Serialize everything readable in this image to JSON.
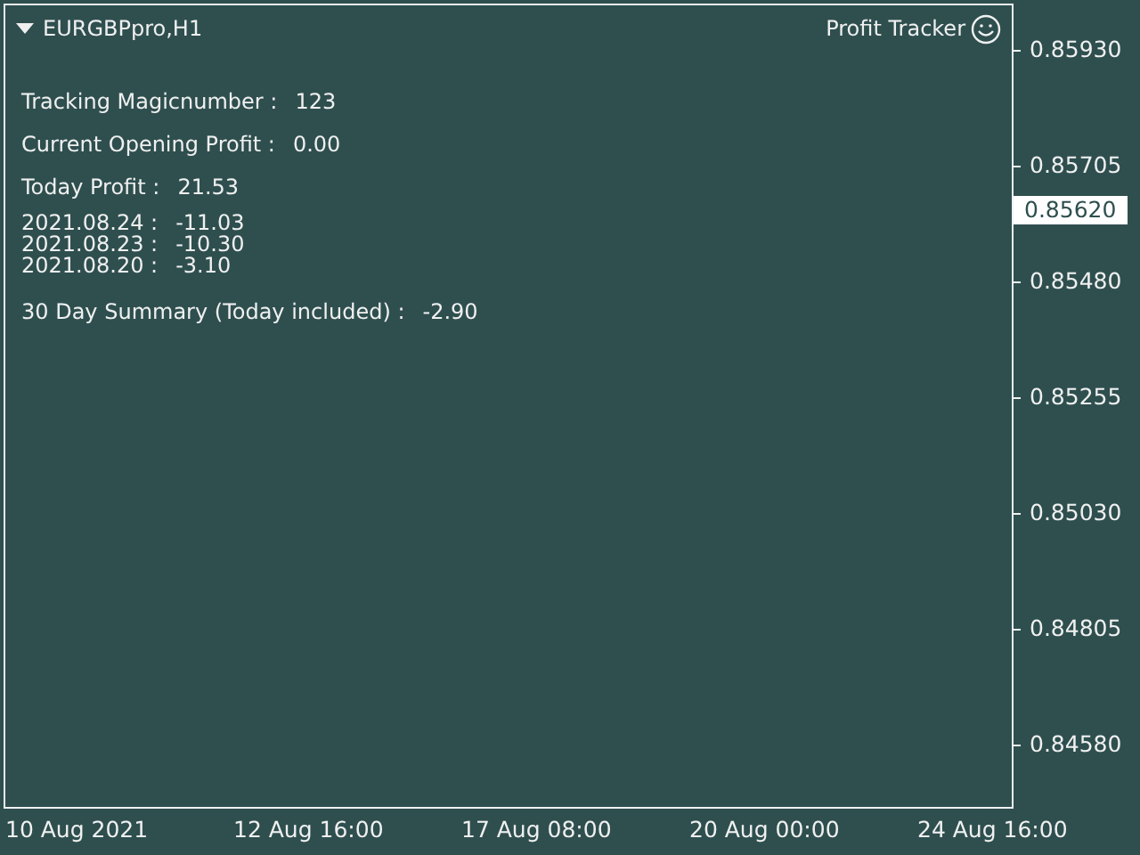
{
  "chart": {
    "symbol": "EURGBPpro,H1",
    "indicator_name": "Profit Tracker",
    "stats": [
      {
        "label": "Tracking Magicnumber :",
        "value": "123"
      },
      {
        "label": "Current Opening Profit :",
        "value": "0.00"
      },
      {
        "label": "Today Profit :",
        "value": "21.53"
      }
    ],
    "daily": [
      {
        "date": "2021.08.24 :",
        "value": "-11.03"
      },
      {
        "date": "2021.08.23 :",
        "value": "-10.30"
      },
      {
        "date": "2021.08.20 :",
        "value": "-3.10"
      }
    ],
    "summary": {
      "label": "30 Day Summary (Today included) :",
      "value": "-2.90"
    }
  },
  "price_axis": [
    {
      "label": "0.85930",
      "kind": "tick"
    },
    {
      "label": "0.85705",
      "kind": "tick"
    },
    {
      "label": "0.85620",
      "kind": "current"
    },
    {
      "label": "0.85480",
      "kind": "tick"
    },
    {
      "label": "0.85255",
      "kind": "tick"
    },
    {
      "label": "0.85030",
      "kind": "tick"
    },
    {
      "label": "0.84805",
      "kind": "tick"
    },
    {
      "label": "0.84580",
      "kind": "tick"
    }
  ],
  "time_axis": [
    "10 Aug 2021",
    "12 Aug 16:00",
    "17 Aug 08:00",
    "20 Aug 00:00",
    "24 Aug 16:00"
  ]
}
